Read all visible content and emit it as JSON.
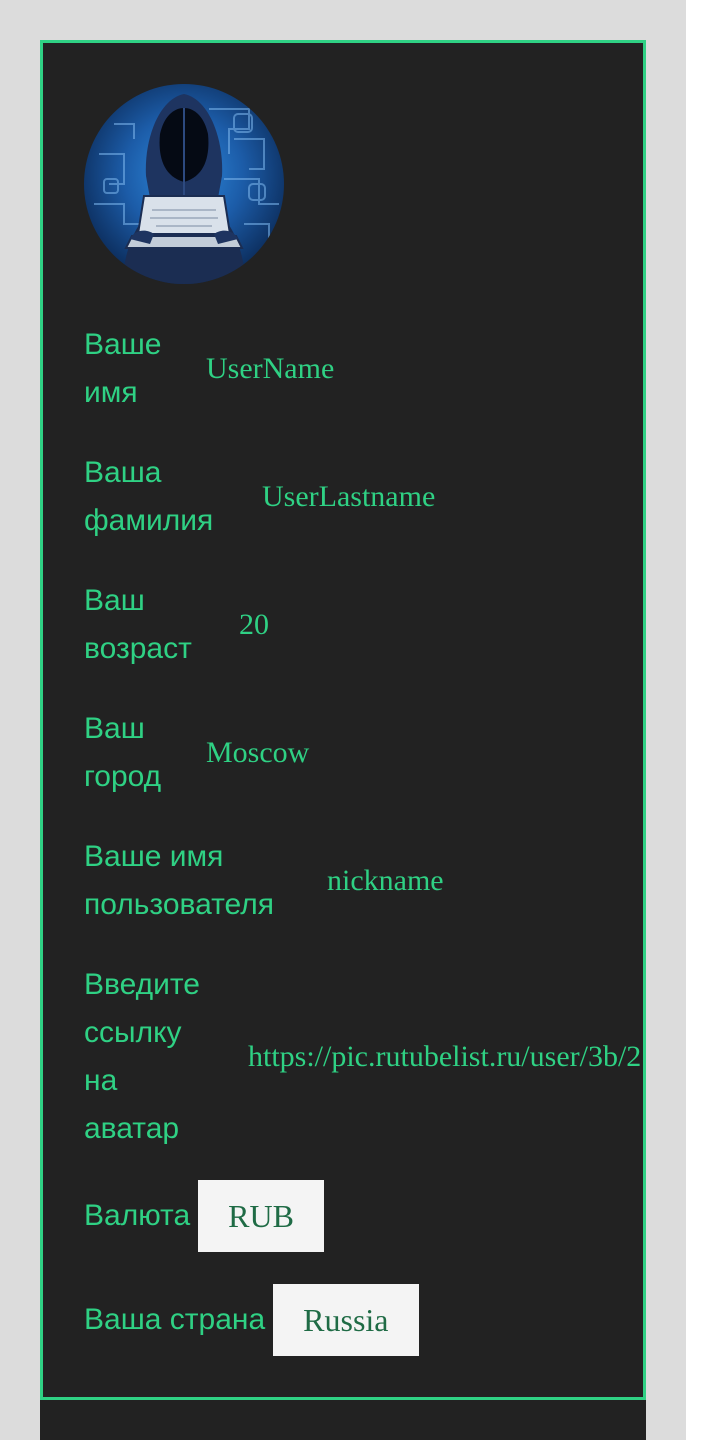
{
  "profile": {
    "avatar_alt": "hacker avatar",
    "fields": [
      {
        "label": "Ваше имя",
        "value": "UserName"
      },
      {
        "label": "Ваша фамилия",
        "value": "UserLastname"
      },
      {
        "label": "Ваш возраст",
        "value": "20"
      },
      {
        "label": "Ваш город",
        "value": "Moscow"
      },
      {
        "label": "Ваше имя пользователя",
        "value": "nickname"
      },
      {
        "label": "Введите ссылку на аватар",
        "value": "https://pic.rutubelist.ru/user/3b/2"
      }
    ],
    "currency": {
      "label": "Валюта",
      "selected": "RUB"
    },
    "country": {
      "label": "Ваша страна",
      "selected": "Russia"
    }
  },
  "colors": {
    "accent": "#2fd184",
    "card_background": "#222222",
    "page_background": "#dcdcdc",
    "select_background": "#f4f4f4",
    "select_text": "#1f6b45"
  }
}
